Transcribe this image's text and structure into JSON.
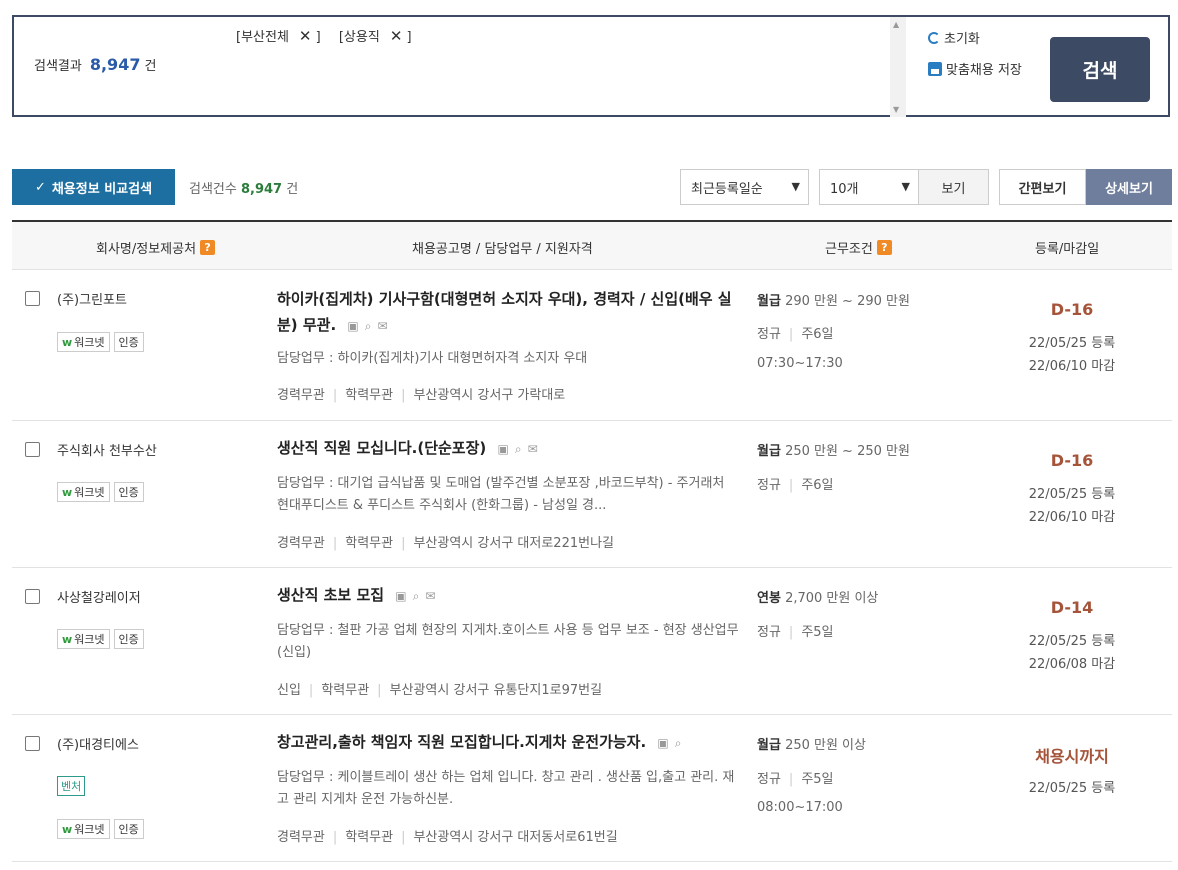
{
  "search": {
    "filters": [
      "[부산전체",
      "[상용직"
    ],
    "filter_close": "]",
    "result_label": "검색결과",
    "result_count": "8,947",
    "result_unit": "건",
    "reset_label": "초기화",
    "save_label": "맞춤채용 저장",
    "search_button": "검색"
  },
  "toolbar": {
    "compare_button": "채용정보 비교검색",
    "count_label": "검색건수",
    "count_value": "8,947",
    "count_unit": "건",
    "sort_selected": "최근등록일순",
    "per_page_selected": "10개",
    "view_button": "보기",
    "mode_simple": "간편보기",
    "mode_detail": "상세보기"
  },
  "table": {
    "headers": [
      "회사명/정보제공처",
      "채용공고명 / 담당업무 / 지원자격",
      "근무조건",
      "등록/마감일"
    ],
    "rows": [
      {
        "company": "(주)그린포트",
        "venture": "",
        "badge_worknet": "워크넷",
        "badge_cert": "인증",
        "title": "하이카(집게차) 기사구함(대형면허 소지자 우대), 경력자 / 신입(배우 실분) 무관.",
        "desc": "담당업무 : 하이카(집게차)기사 대형면허자격 소지자 우대",
        "career": "경력무관",
        "education": "학력무관",
        "location": "부산광역시 강서구 가락대로",
        "pay_type": "월급",
        "pay": "290 만원 ~ 290 만원",
        "employment": "정규",
        "days": "주6일",
        "hours": "07:30~17:30",
        "dday": "D-16",
        "registered": "22/05/25 등록",
        "deadline": "22/06/10 마감"
      },
      {
        "company": "주식회사 천부수산",
        "venture": "",
        "badge_worknet": "워크넷",
        "badge_cert": "인증",
        "title": "생산직 직원 모십니다.(단순포장)",
        "desc": "담당업무 : 대기업 급식납품 및 도매업 (발주건별 소분포장 ,바코드부착) - 주거래처 현대푸디스트 & 푸디스트 주식회사 (한화그룹) - 남성일 경...",
        "career": "경력무관",
        "education": "학력무관",
        "location": "부산광역시 강서구 대저로221번나길",
        "pay_type": "월급",
        "pay": "250 만원 ~ 250 만원",
        "employment": "정규",
        "days": "주6일",
        "hours": "",
        "dday": "D-16",
        "registered": "22/05/25 등록",
        "deadline": "22/06/10 마감"
      },
      {
        "company": "사상철강레이저",
        "venture": "",
        "badge_worknet": "워크넷",
        "badge_cert": "인증",
        "title": "생산직 초보 모집",
        "desc": "담당업무 : 철판 가공 업체 현장의 지게차.호이스트 사용 등 업무 보조 - 현장 생산업무 (신입)",
        "career": "신입",
        "education": "학력무관",
        "location": "부산광역시 강서구 유통단지1로97번길",
        "pay_type": "연봉",
        "pay": "2,700 만원 이상",
        "employment": "정규",
        "days": "주5일",
        "hours": "",
        "dday": "D-14",
        "registered": "22/05/25 등록",
        "deadline": "22/06/08 마감"
      },
      {
        "company": "(주)대경티에스",
        "venture": "벤처",
        "badge_worknet": "워크넷",
        "badge_cert": "인증",
        "title": "창고관리,출하 책임자 직원 모집합니다.지게차 운전가능자.",
        "desc": "담당업무 : 케이블트레이 생산 하는 업체 입니다. 창고 관리 . 생산품 입,출고 관리. 재고 관리 지게차 운전 가능하신분.",
        "career": "경력무관",
        "education": "학력무관",
        "location": "부산광역시 강서구 대저동서로61번길",
        "pay_type": "월급",
        "pay": "250 만원 이상",
        "employment": "정규",
        "days": "주5일",
        "hours": "08:00~17:00",
        "dday": "채용시까지",
        "registered": "22/05/25 등록",
        "deadline": ""
      }
    ]
  },
  "icons": {
    "scrap": "scrap-icon",
    "search": "magnifier-icon",
    "mail": "mail-apply-icon"
  },
  "colors": {
    "accent": "#3d4a63",
    "compare": "#1e6fa1",
    "dday": "#a5543a",
    "help": "#f08a24"
  }
}
